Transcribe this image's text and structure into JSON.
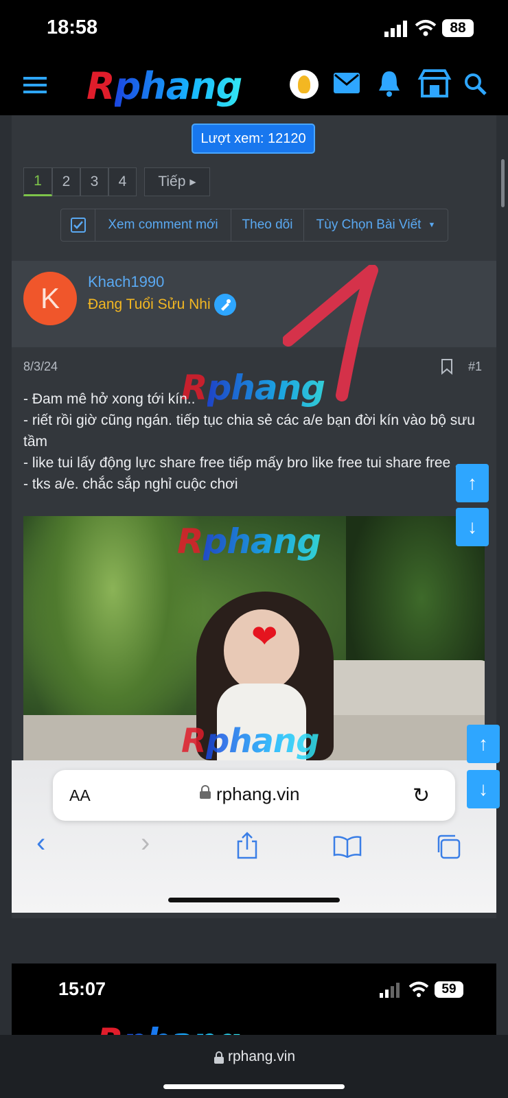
{
  "status_bar": {
    "time": "18:58",
    "battery": "88"
  },
  "nav": {
    "logo_r": "R",
    "logo_rest": "phang",
    "icons": [
      "menu-icon",
      "avatar-icon",
      "mail-icon",
      "bell-icon",
      "store-icon",
      "search-icon"
    ]
  },
  "views_badge": "Lượt xem: 12120",
  "pagination": {
    "pages": [
      "1",
      "2",
      "3",
      "4"
    ],
    "next": "Tiếp"
  },
  "toolbar": {
    "new_comments": "Xem comment mới",
    "follow": "Theo dõi",
    "options": "Tùy Chọn Bài Viết"
  },
  "post": {
    "avatar_letter": "K",
    "username": "Khach1990",
    "user_title": "Đang Tuổi Sửu Nhi",
    "date": "8/3/24",
    "post_number": "#1",
    "lines": [
      "- Đam mê hở xong tới kín..",
      "- riết rồi giờ cũng ngán. tiếp tục chia sẻ các a/e bạn đời kín vào bộ sưu tầm",
      "- like tui lấy động lực share free tiếp mấy bro like free tui share free ,",
      "- tks a/e. chắc sắp nghỉ cuộc chơi"
    ]
  },
  "safari_embedded": {
    "aa": "AA",
    "url": "rphang.vin"
  },
  "embedded_status": {
    "time": "15:07",
    "battery": "59"
  },
  "bottom_url": "rphang.vin",
  "colors": {
    "accent": "#2ea6ff",
    "link": "#5aa9f2",
    "gold": "#f3b722",
    "avatar": "#f0562b"
  }
}
